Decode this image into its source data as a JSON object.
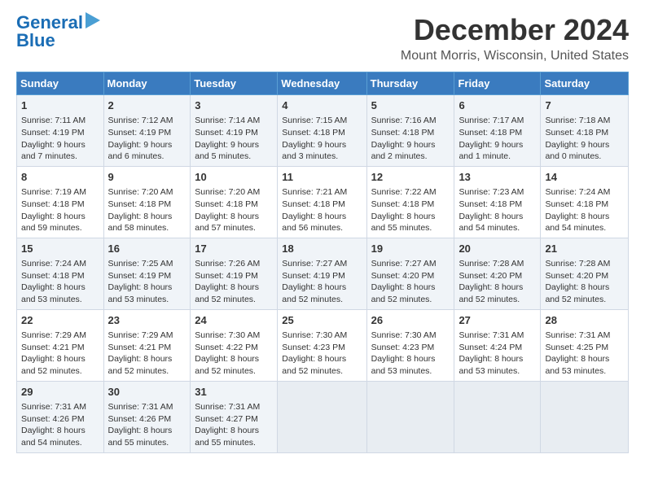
{
  "logo": {
    "line1": "General",
    "line2": "Blue"
  },
  "title": "December 2024",
  "location": "Mount Morris, Wisconsin, United States",
  "days_of_week": [
    "Sunday",
    "Monday",
    "Tuesday",
    "Wednesday",
    "Thursday",
    "Friday",
    "Saturday"
  ],
  "weeks": [
    [
      {
        "day": 1,
        "sunrise": "7:11 AM",
        "sunset": "4:19 PM",
        "daylight": "9 hours and 7 minutes."
      },
      {
        "day": 2,
        "sunrise": "7:12 AM",
        "sunset": "4:19 PM",
        "daylight": "9 hours and 6 minutes."
      },
      {
        "day": 3,
        "sunrise": "7:14 AM",
        "sunset": "4:19 PM",
        "daylight": "9 hours and 5 minutes."
      },
      {
        "day": 4,
        "sunrise": "7:15 AM",
        "sunset": "4:18 PM",
        "daylight": "9 hours and 3 minutes."
      },
      {
        "day": 5,
        "sunrise": "7:16 AM",
        "sunset": "4:18 PM",
        "daylight": "9 hours and 2 minutes."
      },
      {
        "day": 6,
        "sunrise": "7:17 AM",
        "sunset": "4:18 PM",
        "daylight": "9 hours and 1 minute."
      },
      {
        "day": 7,
        "sunrise": "7:18 AM",
        "sunset": "4:18 PM",
        "daylight": "9 hours and 0 minutes."
      }
    ],
    [
      {
        "day": 8,
        "sunrise": "7:19 AM",
        "sunset": "4:18 PM",
        "daylight": "8 hours and 59 minutes."
      },
      {
        "day": 9,
        "sunrise": "7:20 AM",
        "sunset": "4:18 PM",
        "daylight": "8 hours and 58 minutes."
      },
      {
        "day": 10,
        "sunrise": "7:20 AM",
        "sunset": "4:18 PM",
        "daylight": "8 hours and 57 minutes."
      },
      {
        "day": 11,
        "sunrise": "7:21 AM",
        "sunset": "4:18 PM",
        "daylight": "8 hours and 56 minutes."
      },
      {
        "day": 12,
        "sunrise": "7:22 AM",
        "sunset": "4:18 PM",
        "daylight": "8 hours and 55 minutes."
      },
      {
        "day": 13,
        "sunrise": "7:23 AM",
        "sunset": "4:18 PM",
        "daylight": "8 hours and 54 minutes."
      },
      {
        "day": 14,
        "sunrise": "7:24 AM",
        "sunset": "4:18 PM",
        "daylight": "8 hours and 54 minutes."
      }
    ],
    [
      {
        "day": 15,
        "sunrise": "7:24 AM",
        "sunset": "4:18 PM",
        "daylight": "8 hours and 53 minutes."
      },
      {
        "day": 16,
        "sunrise": "7:25 AM",
        "sunset": "4:19 PM",
        "daylight": "8 hours and 53 minutes."
      },
      {
        "day": 17,
        "sunrise": "7:26 AM",
        "sunset": "4:19 PM",
        "daylight": "8 hours and 52 minutes."
      },
      {
        "day": 18,
        "sunrise": "7:27 AM",
        "sunset": "4:19 PM",
        "daylight": "8 hours and 52 minutes."
      },
      {
        "day": 19,
        "sunrise": "7:27 AM",
        "sunset": "4:20 PM",
        "daylight": "8 hours and 52 minutes."
      },
      {
        "day": 20,
        "sunrise": "7:28 AM",
        "sunset": "4:20 PM",
        "daylight": "8 hours and 52 minutes."
      },
      {
        "day": 21,
        "sunrise": "7:28 AM",
        "sunset": "4:20 PM",
        "daylight": "8 hours and 52 minutes."
      }
    ],
    [
      {
        "day": 22,
        "sunrise": "7:29 AM",
        "sunset": "4:21 PM",
        "daylight": "8 hours and 52 minutes."
      },
      {
        "day": 23,
        "sunrise": "7:29 AM",
        "sunset": "4:21 PM",
        "daylight": "8 hours and 52 minutes."
      },
      {
        "day": 24,
        "sunrise": "7:30 AM",
        "sunset": "4:22 PM",
        "daylight": "8 hours and 52 minutes."
      },
      {
        "day": 25,
        "sunrise": "7:30 AM",
        "sunset": "4:23 PM",
        "daylight": "8 hours and 52 minutes."
      },
      {
        "day": 26,
        "sunrise": "7:30 AM",
        "sunset": "4:23 PM",
        "daylight": "8 hours and 53 minutes."
      },
      {
        "day": 27,
        "sunrise": "7:31 AM",
        "sunset": "4:24 PM",
        "daylight": "8 hours and 53 minutes."
      },
      {
        "day": 28,
        "sunrise": "7:31 AM",
        "sunset": "4:25 PM",
        "daylight": "8 hours and 53 minutes."
      }
    ],
    [
      {
        "day": 29,
        "sunrise": "7:31 AM",
        "sunset": "4:26 PM",
        "daylight": "8 hours and 54 minutes."
      },
      {
        "day": 30,
        "sunrise": "7:31 AM",
        "sunset": "4:26 PM",
        "daylight": "8 hours and 55 minutes."
      },
      {
        "day": 31,
        "sunrise": "7:31 AM",
        "sunset": "4:27 PM",
        "daylight": "8 hours and 55 minutes."
      },
      null,
      null,
      null,
      null
    ]
  ]
}
